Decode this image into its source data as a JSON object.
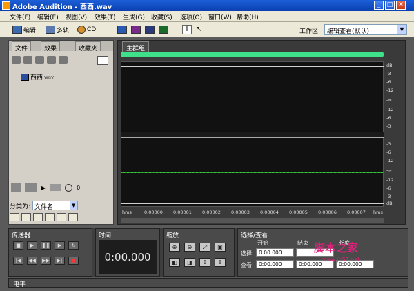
{
  "window": {
    "title": "Adobe Audition - 西西.wav"
  },
  "menu": [
    "文件(F)",
    "编辑(E)",
    "视图(V)",
    "效果(T)",
    "生成(G)",
    "收藏(S)",
    "选项(O)",
    "窗口(W)",
    "帮助(H)"
  ],
  "toolbar": {
    "edit": "编辑",
    "multitrack": "多轨",
    "cd": "CD",
    "workspace_label": "工作区:",
    "workspace_value": "编辑查看(默认)"
  },
  "left_panel": {
    "tabs": [
      "文件",
      "效果",
      "收藏夹"
    ],
    "file_name": "西西",
    "file_ext": "wav",
    "sort_label": "分类为:",
    "sort_value": "文件名",
    "counter": "0"
  },
  "main": {
    "tab": "主群组",
    "db_labels_ch1": [
      "dB",
      "-3",
      "-6",
      "-12",
      "-∞",
      "-12",
      "-6",
      "-3"
    ],
    "db_labels_ch2": [
      "-3",
      "-6",
      "-12",
      "-∞",
      "-12",
      "-6",
      "-3",
      "dB"
    ],
    "time_labels": [
      "hms",
      "0.00000",
      "0.00001",
      "0.00002",
      "0.00003",
      "0.00004",
      "0.00005",
      "0.00006",
      "0.00007",
      "hms"
    ]
  },
  "transport": {
    "title": "传送器"
  },
  "time_panel": {
    "title": "时间",
    "value": "0:00.000"
  },
  "zoom_panel": {
    "title": "缩放"
  },
  "selection_panel": {
    "title": "选择/查看",
    "col_start": "开始",
    "col_end": "结束",
    "col_length": "长度",
    "row_select": "选择",
    "row_view": "查看",
    "sel_start": "0:00.000",
    "sel_end": "",
    "view_start": "0:00.000",
    "view_end": "0:00.000",
    "view_length": "0:00.000"
  },
  "levels_panel": {
    "title": "电平"
  },
  "watermark": {
    "text": "脚本之家",
    "url": "www.jb51.net"
  }
}
